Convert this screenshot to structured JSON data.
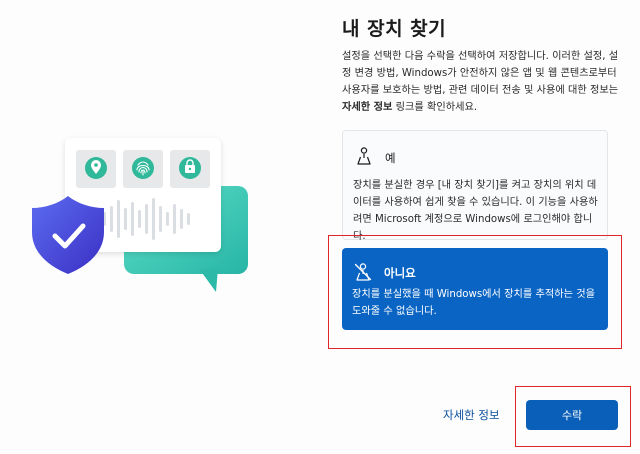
{
  "page": {
    "title": "내 장치 찾기",
    "description": {
      "main": "설정을 선택한 다음 수락을 선택하여 저장합니다. 이러한 설정, 설정 변경 방법, Windows가 안전하지 않은 앱 및 웹 콘텐츠로부터 사용자를 보호하는 방법, 관련 데이터 전송 및 사용에 대한 정보는 ",
      "bold_link": "자세한 정보",
      "tail": " 링크를 확인하세요."
    }
  },
  "options": [
    {
      "label": "예",
      "icon": "location-person-icon",
      "description": "장치를 분실한 경우 [내 장치 찾기]를 켜고 장치의 위치 데이터를 사용하여 쉽게 찾을 수 있습니다. 이 기능을 사용하려면 Microsoft 계정으로 Windows에 로그인해야 합니다.",
      "selected": false
    },
    {
      "label": "아니요",
      "icon": "location-off-icon",
      "description": "장치를 분실했을 때 Windows에서 장치를 추적하는 것을 도와줄 수 없습니다.",
      "selected": true
    }
  ],
  "footer": {
    "learn_more": "자세한 정보",
    "accept": "수락"
  },
  "colors": {
    "accent": "#0a64c4",
    "highlight": "#e0262c",
    "teal": "#3fcfb8",
    "shield": "#4e55e0"
  },
  "illustration_icons": [
    "location-pin-icon",
    "fingerprint-icon",
    "lock-icon",
    "shield-check-icon"
  ]
}
